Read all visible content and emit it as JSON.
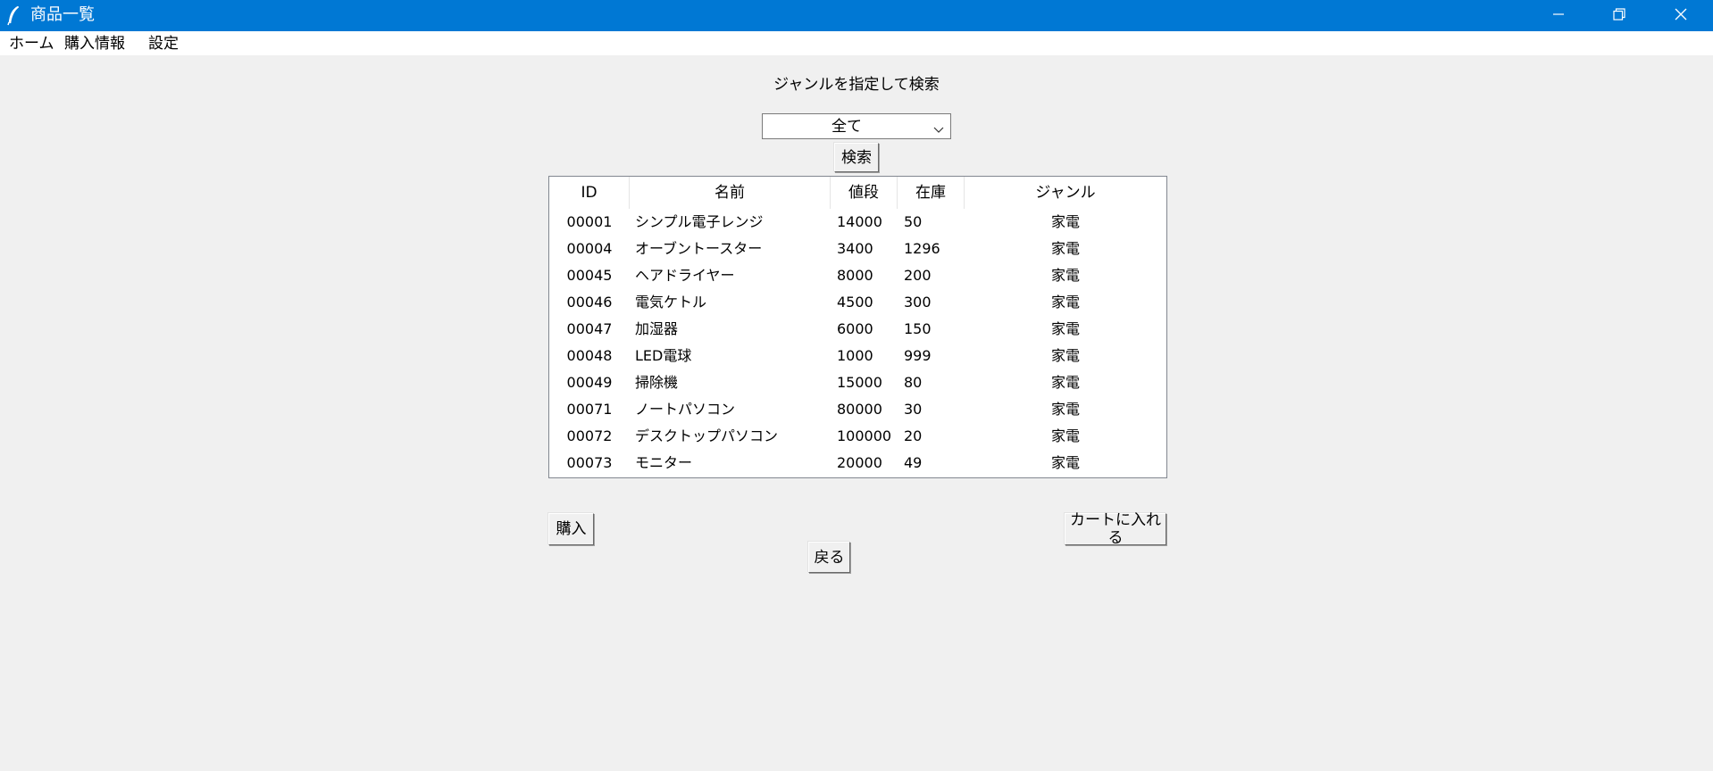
{
  "window": {
    "title": "商品一覧",
    "titlebar_color": "#0078d4"
  },
  "menu": {
    "items": [
      "ホーム",
      "購入情報",
      "設定"
    ]
  },
  "search": {
    "label": "ジャンルを指定して検索",
    "genre_selected": "全て",
    "button_label": "検索"
  },
  "table": {
    "columns": [
      "ID",
      "名前",
      "値段",
      "在庫",
      "ジャンル"
    ],
    "rows": [
      {
        "id": "00001",
        "name": "シンプル電子レンジ",
        "price": "14000",
        "stock": "50",
        "genre": "家電"
      },
      {
        "id": "00004",
        "name": "オーブントースター",
        "price": "3400",
        "stock": "1296",
        "genre": "家電"
      },
      {
        "id": "00045",
        "name": "ヘアドライヤー",
        "price": "8000",
        "stock": "200",
        "genre": "家電"
      },
      {
        "id": "00046",
        "name": "電気ケトル",
        "price": "4500",
        "stock": "300",
        "genre": "家電"
      },
      {
        "id": "00047",
        "name": "加湿器",
        "price": "6000",
        "stock": "150",
        "genre": "家電"
      },
      {
        "id": "00048",
        "name": "LED電球",
        "price": "1000",
        "stock": "999",
        "genre": "家電"
      },
      {
        "id": "00049",
        "name": "掃除機",
        "price": "15000",
        "stock": "80",
        "genre": "家電"
      },
      {
        "id": "00071",
        "name": "ノートパソコン",
        "price": "80000",
        "stock": "30",
        "genre": "家電"
      },
      {
        "id": "00072",
        "name": "デスクトップパソコン",
        "price": "100000",
        "stock": "20",
        "genre": "家電"
      },
      {
        "id": "00073",
        "name": "モニター",
        "price": "20000",
        "stock": "49",
        "genre": "家電"
      }
    ]
  },
  "actions": {
    "buy_label": "購入",
    "cart_label": "カートに入れる",
    "back_label": "戻る"
  }
}
